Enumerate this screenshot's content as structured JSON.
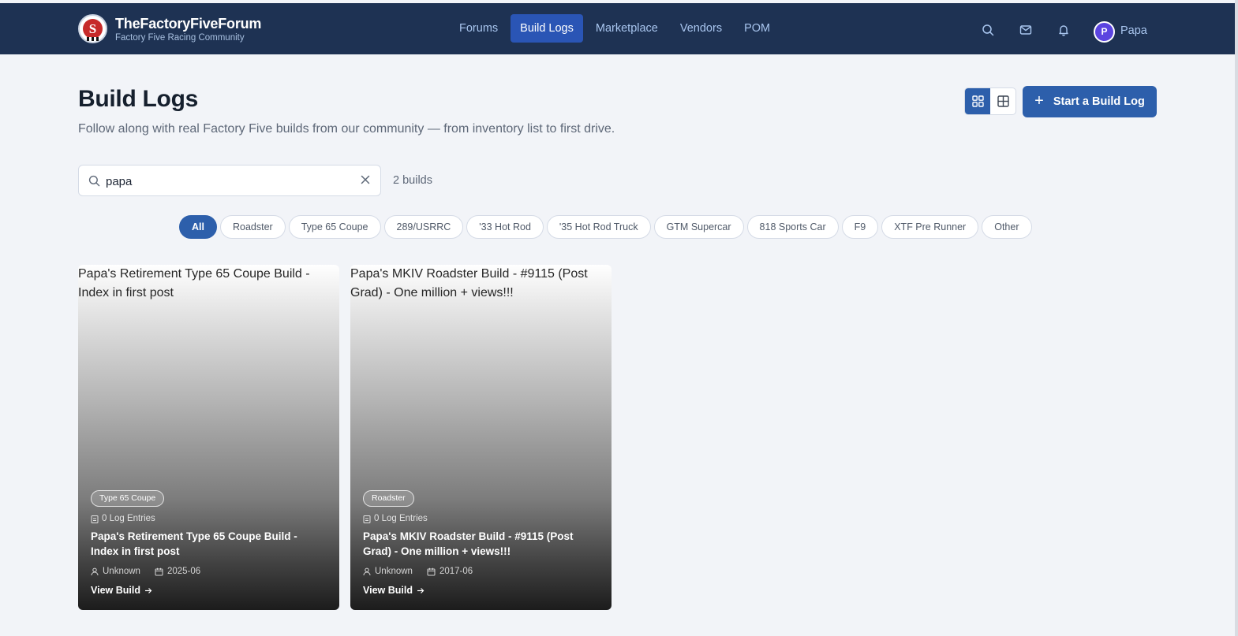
{
  "header": {
    "brand_title": "TheFactoryFiveForum",
    "brand_subtitle": "Factory Five Racing Community",
    "logo_letter": "S",
    "nav": [
      {
        "label": "Forums",
        "active": false
      },
      {
        "label": "Build Logs",
        "active": true
      },
      {
        "label": "Marketplace",
        "active": false
      },
      {
        "label": "Vendors",
        "active": false
      },
      {
        "label": "POM",
        "active": false
      }
    ],
    "icons": [
      "search-icon",
      "mail-icon",
      "bell-icon"
    ],
    "user": {
      "initial": "P",
      "name": "Papa"
    }
  },
  "page": {
    "title": "Build Logs",
    "subtitle": "Follow along with real Factory Five builds from our community — from inventory list to first drive.",
    "start_button": "Start a Build Log",
    "view_modes": [
      "grid",
      "table"
    ]
  },
  "search": {
    "value": "papa",
    "placeholder": "",
    "count_label": "2 builds"
  },
  "filters": [
    {
      "label": "All",
      "active": true
    },
    {
      "label": "Roadster",
      "active": false
    },
    {
      "label": "Type 65 Coupe",
      "active": false
    },
    {
      "label": "289/USRRC",
      "active": false
    },
    {
      "label": "'33 Hot Rod",
      "active": false
    },
    {
      "label": "'35 Hot Rod Truck",
      "active": false
    },
    {
      "label": "GTM Supercar",
      "active": false
    },
    {
      "label": "818 Sports Car",
      "active": false
    },
    {
      "label": "F9",
      "active": false
    },
    {
      "label": "XTF Pre Runner",
      "active": false
    },
    {
      "label": "Other",
      "active": false
    }
  ],
  "cards": [
    {
      "image_alt": "Papa's Retirement Type 65 Coupe Build - Index in first post",
      "tag": "Type 65 Coupe",
      "entries": "0 Log Entries",
      "title": "Papa's Retirement Type 65 Coupe Build - Index in first post",
      "author": "Unknown",
      "date": "2025-06",
      "link": "View Build"
    },
    {
      "image_alt": "Papa's MKIV Roadster Build - #9115 (Post Grad) - One million + views!!!",
      "tag": "Roadster",
      "entries": "0 Log Entries",
      "title": "Papa's MKIV Roadster Build - #9115 (Post Grad) - One million + views!!!",
      "author": "Unknown",
      "date": "2017-06",
      "link": "View Build"
    }
  ],
  "colors": {
    "header_bg": "#1e3253",
    "nav_active": "#2a55b5",
    "accent": "#2d5fab",
    "avatar": "#5b44e0",
    "page_bg": "#f2f4f8"
  }
}
